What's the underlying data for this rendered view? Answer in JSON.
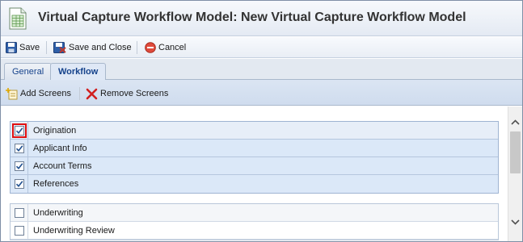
{
  "window": {
    "title": "Virtual Capture Workflow Model: New Virtual Capture Workflow Model",
    "icon": "spreadsheet-icon"
  },
  "toolbar": {
    "save_label": "Save",
    "save_close_label": "Save and Close",
    "cancel_label": "Cancel"
  },
  "tabs": [
    {
      "label": "General",
      "active": false
    },
    {
      "label": "Workflow",
      "active": true
    }
  ],
  "subtoolbar": {
    "add_screens_label": "Add Screens",
    "remove_screens_label": "Remove Screens"
  },
  "groups": [
    {
      "header": {
        "label": "Origination",
        "checked": true,
        "focused": true
      },
      "items": [
        {
          "label": "Applicant Info",
          "checked": true
        },
        {
          "label": "Account Terms",
          "checked": true
        },
        {
          "label": "References",
          "checked": true
        }
      ]
    },
    {
      "header": {
        "label": "Underwriting",
        "checked": false
      },
      "items": [
        {
          "label": "Underwriting Review",
          "checked": false
        }
      ]
    }
  ],
  "colors": {
    "accent": "#15428b",
    "checked_group_bg": "#dbe8f8",
    "focus_outline": "#e01010"
  }
}
